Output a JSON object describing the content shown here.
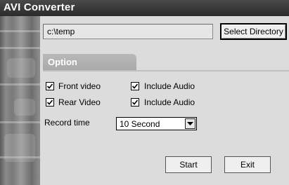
{
  "window": {
    "title": "AVI Converter"
  },
  "directory": {
    "path": "c:\\temp",
    "select_button": "Select Directory"
  },
  "option_tab": {
    "label": "Option"
  },
  "checkboxes": [
    {
      "label": "Front video",
      "checked": true
    },
    {
      "label": "Include Audio",
      "checked": true
    },
    {
      "label": "Rear Video",
      "checked": true
    },
    {
      "label": "Include Audio",
      "checked": true
    }
  ],
  "record_time": {
    "label": "Record time",
    "value": "10 Second"
  },
  "buttons": {
    "start": "Start",
    "exit": "Exit"
  },
  "icons": {
    "checkbox_mark": "checkmark-icon",
    "combo_arrow": "chevron-down-icon"
  }
}
